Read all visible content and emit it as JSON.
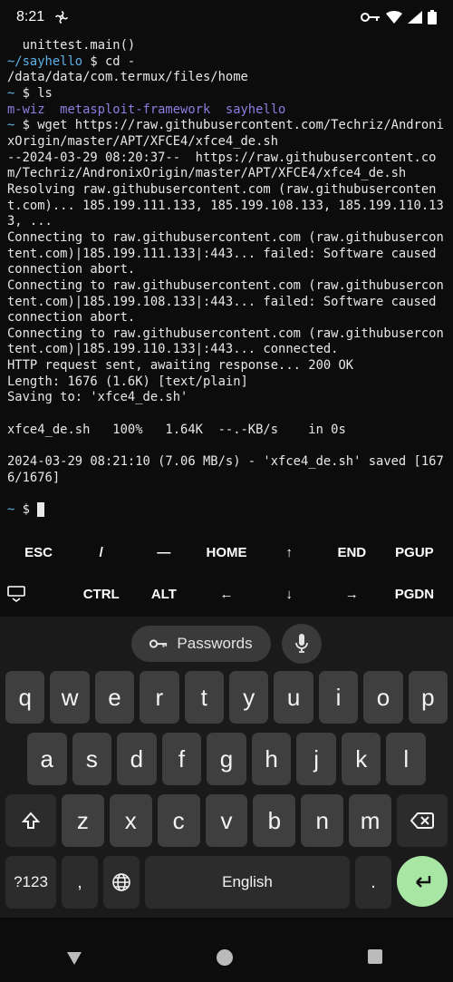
{
  "status": {
    "time": "8:21"
  },
  "terminal": {
    "lines": [
      {
        "pre": "  ",
        "text": "unittest.main()"
      },
      {
        "path": "~/sayhello",
        "prompt": " $ ",
        "text": "cd -"
      },
      {
        "text": "/data/data/com.termux/files/home"
      },
      {
        "path": "~",
        "prompt": " $ ",
        "text": "ls"
      },
      {
        "dirs": "m-wiz  metasploit-framework  sayhello"
      },
      {
        "path": "~",
        "prompt": " $ ",
        "text": "wget https://raw.githubusercontent.com/Techriz/AndronixOrigin/master/APT/XFCE4/xfce4_de.sh"
      },
      {
        "text": "--2024-03-29 08:20:37--  https://raw.githubusercontent.com/Techriz/AndronixOrigin/master/APT/XFCE4/xfce4_de.sh"
      },
      {
        "text": "Resolving raw.githubusercontent.com (raw.githubusercontent.com)... 185.199.111.133, 185.199.108.133, 185.199.110.133, ..."
      },
      {
        "text": "Connecting to raw.githubusercontent.com (raw.githubusercontent.com)|185.199.111.133|:443... failed: Software caused connection abort."
      },
      {
        "text": "Connecting to raw.githubusercontent.com (raw.githubusercontent.com)|185.199.108.133|:443... failed: Software caused connection abort."
      },
      {
        "text": "Connecting to raw.githubusercontent.com (raw.githubusercontent.com)|185.199.110.133|:443... connected."
      },
      {
        "text": "HTTP request sent, awaiting response... 200 OK"
      },
      {
        "text": "Length: 1676 (1.6K) [text/plain]"
      },
      {
        "text": "Saving to: 'xfce4_de.sh'"
      },
      {
        "blank": true
      },
      {
        "text": "xfce4_de.sh   100%   1.64K  --.-KB/s    in 0s"
      },
      {
        "blank": true
      },
      {
        "text": "2024-03-29 08:21:10 (7.06 MB/s) - 'xfce4_de.sh' saved [1676/1676]"
      },
      {
        "blank": true
      },
      {
        "path": "~",
        "prompt": " $ ",
        "cursor": true
      }
    ]
  },
  "termkeys": {
    "row1": [
      "ESC",
      "/",
      "—",
      "HOME",
      "↑",
      "END",
      "PGUP"
    ],
    "row2_icon": "keyboard-collapse-icon",
    "row2": [
      "CTRL",
      "ALT",
      "←",
      "↓",
      "→",
      "PGDN"
    ]
  },
  "keyboard": {
    "passwords_label": "Passwords",
    "row1": [
      "q",
      "w",
      "e",
      "r",
      "t",
      "y",
      "u",
      "i",
      "o",
      "p"
    ],
    "row2": [
      "a",
      "s",
      "d",
      "f",
      "g",
      "h",
      "j",
      "k",
      "l"
    ],
    "row3": [
      "z",
      "x",
      "c",
      "v",
      "b",
      "n",
      "m"
    ],
    "numswitch": "?123",
    "comma": ",",
    "space": "English",
    "period": "."
  }
}
